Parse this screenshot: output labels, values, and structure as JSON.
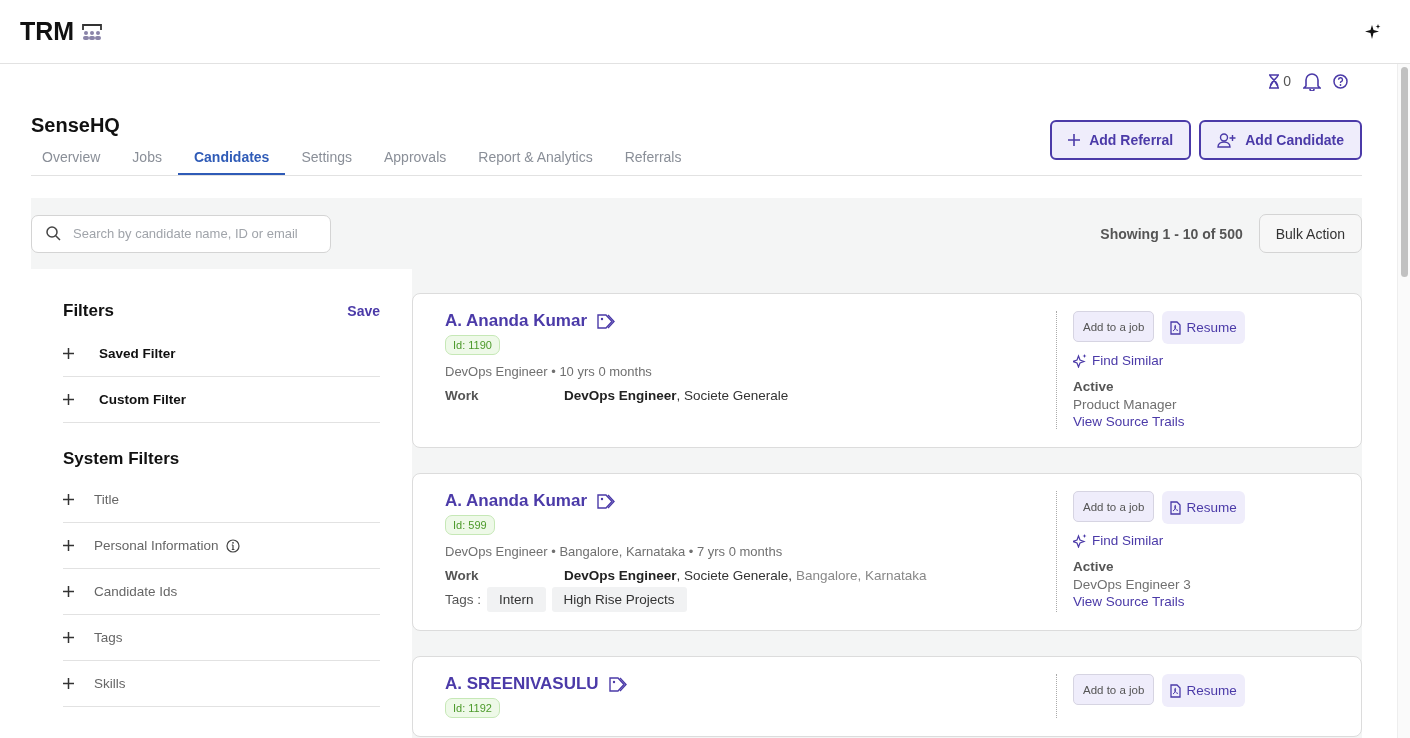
{
  "app": {
    "logo": "TRM"
  },
  "toolbar": {
    "pending_count": "0"
  },
  "page": {
    "title": "SenseHQ"
  },
  "tabs": [
    {
      "label": "Overview",
      "selected": false
    },
    {
      "label": "Jobs",
      "selected": false
    },
    {
      "label": "Candidates",
      "selected": true
    },
    {
      "label": "Settings",
      "selected": false
    },
    {
      "label": "Approvals",
      "selected": false
    },
    {
      "label": "Report & Analytics",
      "selected": false
    },
    {
      "label": "Referrals",
      "selected": false
    }
  ],
  "actions": [
    {
      "kind": "referral",
      "label": "Add Referral"
    },
    {
      "kind": "candidate",
      "label": "Add Candidate"
    }
  ],
  "search": {
    "placeholder": "Search by candidate name, ID or email"
  },
  "results": {
    "summary": "Showing 1 - 10 of 500",
    "bulk_action": "Bulk Action"
  },
  "filters": {
    "title": "Filters",
    "save": "Save",
    "user_filters": [
      {
        "label": "Saved Filter"
      },
      {
        "label": "Custom Filter"
      }
    ],
    "system_title": "System Filters",
    "system_filters": [
      {
        "label": "Title",
        "info": false
      },
      {
        "label": "Personal Information",
        "info": true
      },
      {
        "label": "Candidate Ids",
        "info": false
      },
      {
        "label": "Tags",
        "info": false
      },
      {
        "label": "Skills",
        "info": false
      }
    ]
  },
  "candidates": [
    {
      "name": "A. Ananda Kumar",
      "id": "Id: 1190",
      "summary": "DevOps Engineer • 10 yrs 0 months",
      "work_label": "Work",
      "work_title": "DevOps Engineer",
      "work_company": ", Societe Generale",
      "add_job": "Add to a job",
      "resume": "Resume",
      "find_similar": "Find Similar",
      "status": "Active",
      "job": "Product Manager",
      "source_link": "View Source Trails"
    },
    {
      "name": "A. Ananda Kumar",
      "id": "Id: 599",
      "summary": "DevOps Engineer • Bangalore, Karnataka • 7 yrs 0 months",
      "work_label": "Work",
      "work_title": "DevOps Engineer",
      "work_company": ", Societe Generale,",
      "work_location": " Bangalore, Karnataka",
      "tags_label": "Tags :",
      "tags": [
        "Intern",
        "High Rise Projects"
      ],
      "add_job": "Add to a job",
      "resume": "Resume",
      "find_similar": "Find Similar",
      "status": "Active",
      "job": "DevOps Engineer 3",
      "source_link": "View Source Trails"
    },
    {
      "name": "A. SREENIVASULU",
      "id": "Id: 1192",
      "add_job": "Add to a job",
      "resume": "Resume"
    }
  ]
}
